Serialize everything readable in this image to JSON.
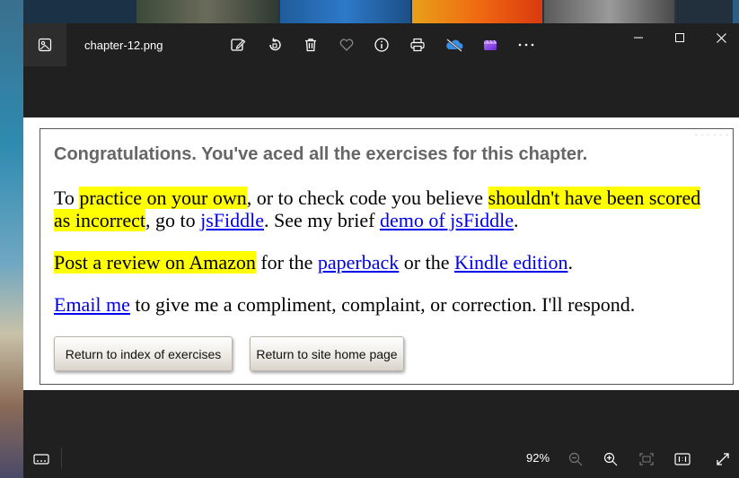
{
  "window": {
    "file_name": "chapter-12.png"
  },
  "toolbar": {
    "icons": [
      "edit-image-icon",
      "rotate-icon",
      "delete-icon",
      "favorite-icon",
      "info-icon",
      "print-icon",
      "onedrive-icon",
      "clipchamp-icon",
      "more-icon"
    ]
  },
  "content": {
    "heading": "Congratulations. You've aced all the exercises for this chapter.",
    "p1": {
      "t1": "To ",
      "h1": "practice on your own",
      "t2": ", or to check code you believe ",
      "h2": "shouldn't have been scored as incorrect",
      "t3": ", go to ",
      "link1": "jsFiddle",
      "t4": ". See my brief ",
      "link2": "demo of jsFiddle",
      "t5": "."
    },
    "p2": {
      "h1": "Post a review on Amazon",
      "t1": " for the ",
      "link1": "paperback",
      "t2": " or the ",
      "link2": "Kindle edition",
      "t3": "."
    },
    "p3": {
      "link1": "Email me",
      "t1": " to give me a compliment, complaint, or correction. I'll respond."
    },
    "buttons": {
      "index": "Return to index of exercises",
      "home": "Return to site home page"
    },
    "corner_dots": "· · · · · ·"
  },
  "statusbar": {
    "zoom": "92%"
  },
  "colors": {
    "highlight": "#ffff00",
    "link": "#0000ee",
    "heading": "#666666",
    "chrome": "#202020"
  }
}
